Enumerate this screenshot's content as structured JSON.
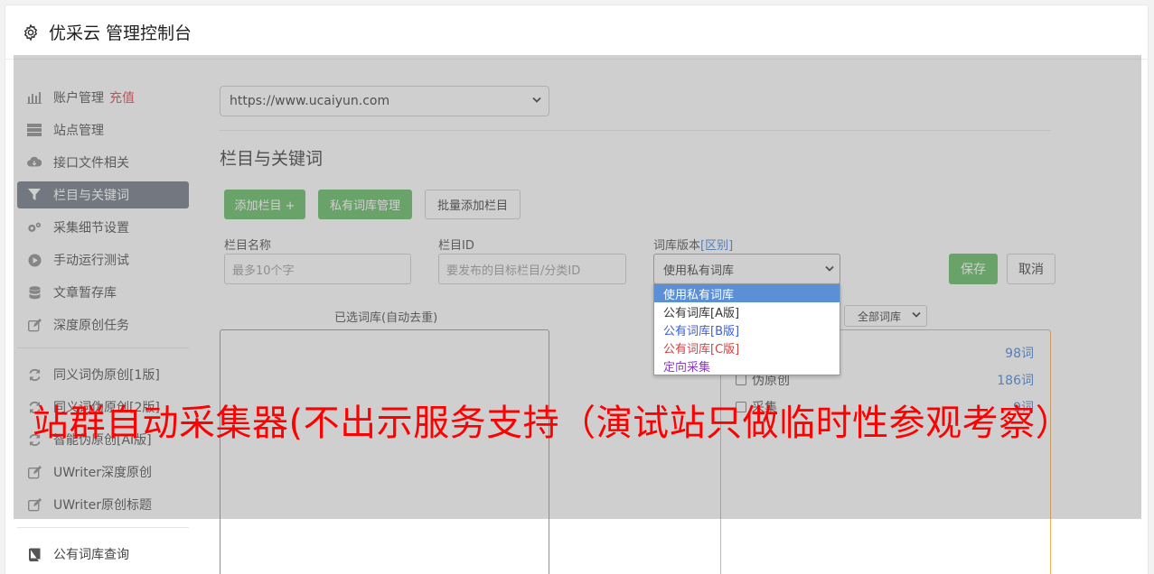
{
  "header": {
    "title": "优采云 管理控制台",
    "icon": "gear-icon"
  },
  "sidebar": {
    "group1": [
      {
        "label": "账户管理",
        "badge": "充值",
        "icon": "bar-chart-icon",
        "active": false
      },
      {
        "label": "站点管理",
        "icon": "server-icon",
        "active": false
      },
      {
        "label": "接口文件相关",
        "icon": "cloud-download-icon",
        "active": false
      },
      {
        "label": "栏目与关键词",
        "icon": "filter-icon",
        "active": true
      },
      {
        "label": "采集细节设置",
        "icon": "cogs-icon",
        "active": false
      },
      {
        "label": "手动运行测试",
        "icon": "play-circle-icon",
        "active": false
      },
      {
        "label": "文章暂存库",
        "icon": "database-icon",
        "active": false
      },
      {
        "label": "深度原创任务",
        "icon": "edit-icon",
        "active": false
      }
    ],
    "group2": [
      {
        "label": "同义词伪原创[1版]",
        "icon": "refresh-icon"
      },
      {
        "label": "同义词伪原创[2版]",
        "icon": "refresh-icon"
      },
      {
        "label": "智能伪原创[AI版]",
        "icon": "refresh-icon"
      },
      {
        "label": "UWriter深度原创",
        "icon": "edit-icon"
      },
      {
        "label": "UWriter原创标题",
        "icon": "edit-icon"
      }
    ],
    "group3": [
      {
        "label": "公有词库查询",
        "icon": "book-icon"
      }
    ]
  },
  "main": {
    "site_select": "https://www.ucaiyun.com",
    "section_title": "栏目与关键词",
    "buttons": {
      "add_column": "添加栏目 +",
      "private_lib": "私有词库管理",
      "batch_add": "批量添加栏目"
    },
    "form": {
      "name_label": "栏目名称",
      "name_placeholder": "最多10个字",
      "id_label": "栏目ID",
      "id_placeholder": "要发布的目标栏目/分类ID",
      "version_label": "词库版本",
      "version_diff": "[区别]",
      "version_selected": "使用私有词库",
      "save": "保存",
      "cancel": "取消"
    },
    "selected_caption": "已选词库(自动去重)",
    "lib_filter": "全部词库",
    "libraries": [
      {
        "name": "",
        "count": "98词"
      },
      {
        "name": "伪原创",
        "count": "186词"
      },
      {
        "name": "采集",
        "count": "9词"
      }
    ]
  },
  "dropdown": {
    "options": [
      "使用私有词库",
      "公有词库[A版]",
      "公有词库[B版]",
      "公有词库[C版]",
      "定向采集"
    ]
  },
  "watermark": "站群自动采集器(不出示服务支持（演试站只做临时性参观考察）",
  "colors": {
    "green": "#5cb85c",
    "active_nav": "#6b7380",
    "red": "#ff0000",
    "blue": "#3c7ed4"
  }
}
